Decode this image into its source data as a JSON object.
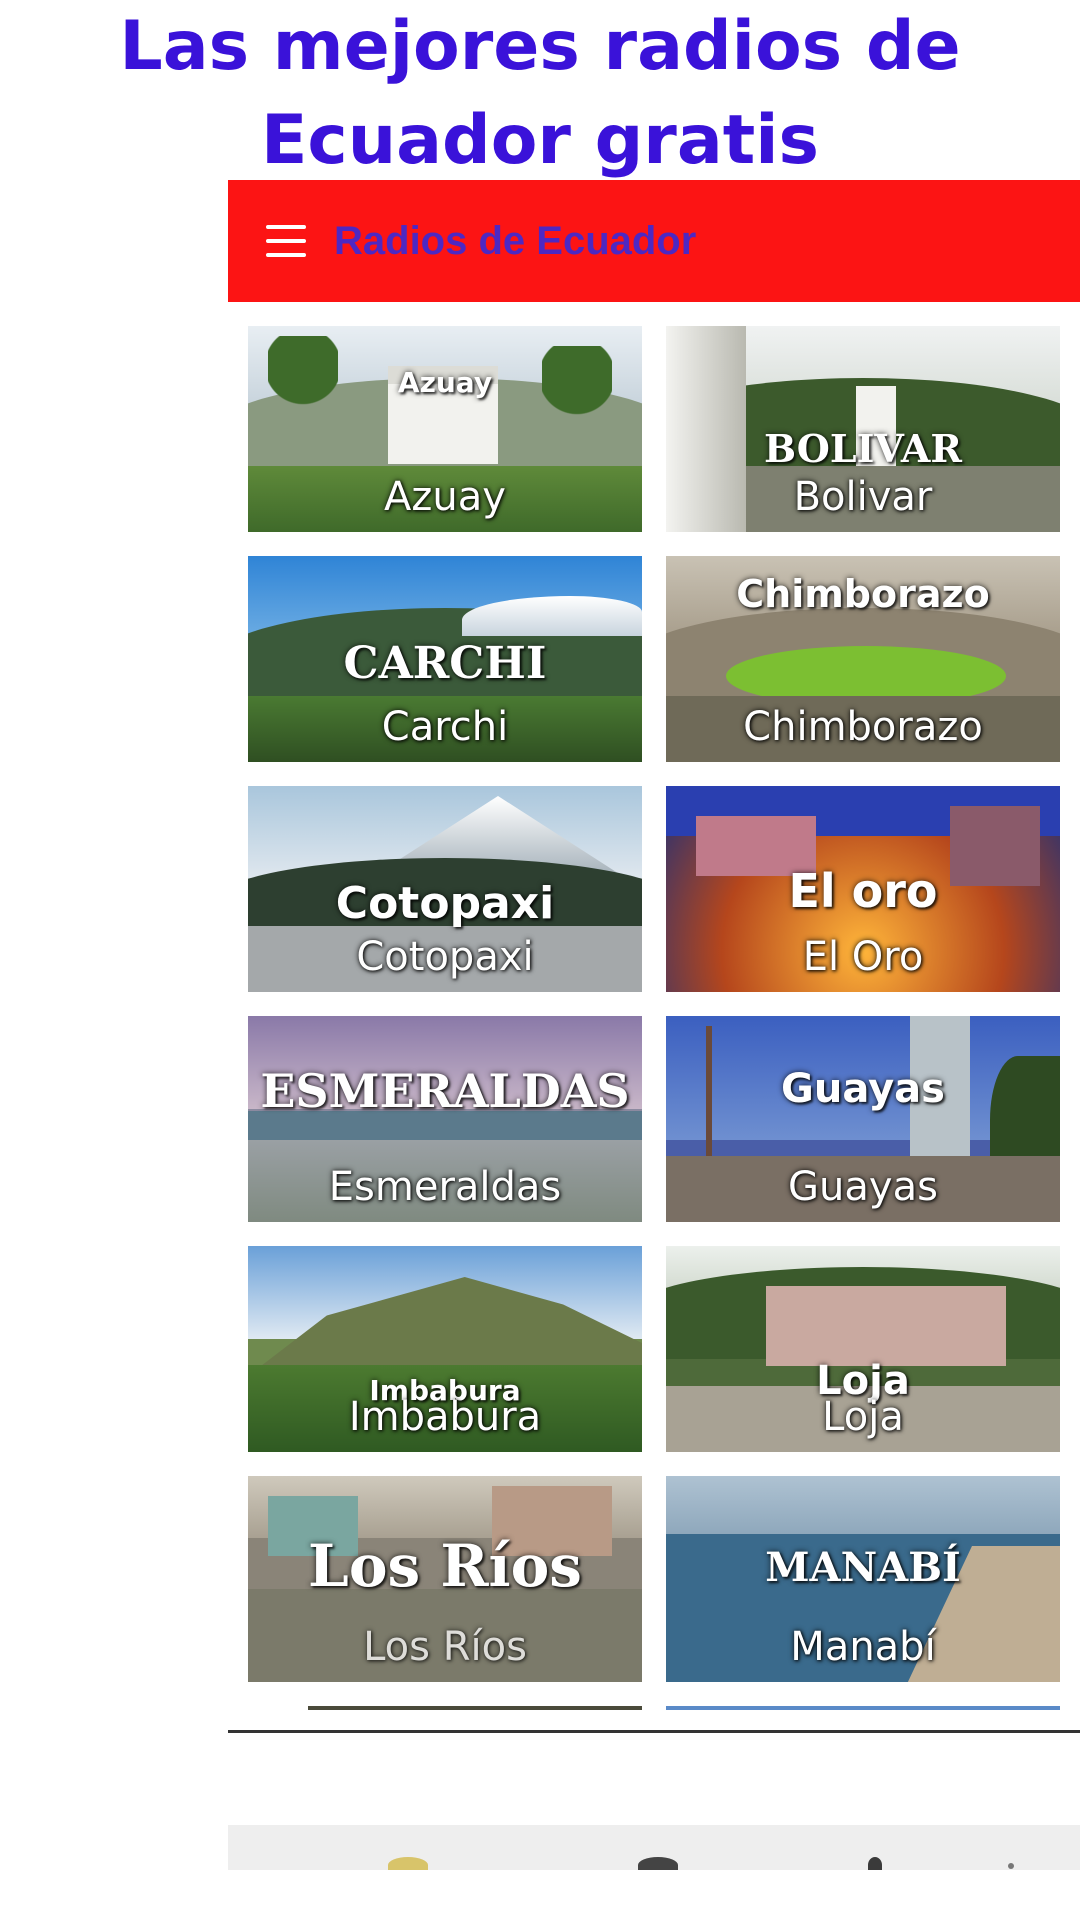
{
  "headline": {
    "line1": "Las mejores radios de",
    "line2": "Ecuador gratis"
  },
  "appbar": {
    "title": "Radios de Ecuador",
    "menu_icon": "menu-icon",
    "background": "#fc1414",
    "title_color": "#3b2bd6"
  },
  "provinces": [
    {
      "label": "Azuay",
      "image_text": "Azuay"
    },
    {
      "label": "Bolivar",
      "image_text": "BOLIVAR"
    },
    {
      "label": "Carchi",
      "image_text": "CARCHI"
    },
    {
      "label": "Chimborazo",
      "image_text": "Chimborazo"
    },
    {
      "label": "Cotopaxi",
      "image_text": "Cotopaxi"
    },
    {
      "label": "El Oro",
      "image_text": "El oro"
    },
    {
      "label": "Esmeraldas",
      "image_text": "ESMERALDAS"
    },
    {
      "label": "Guayas",
      "image_text": "Guayas"
    },
    {
      "label": "Imbabura",
      "image_text": "Imbabura"
    },
    {
      "label": "Loja",
      "image_text": "Loja"
    },
    {
      "label": "Los Ríos",
      "image_text": "Los Ríos"
    },
    {
      "label": "Manabí",
      "image_text": "MANABÍ"
    }
  ],
  "colors": {
    "headline": "#3a12d9"
  }
}
